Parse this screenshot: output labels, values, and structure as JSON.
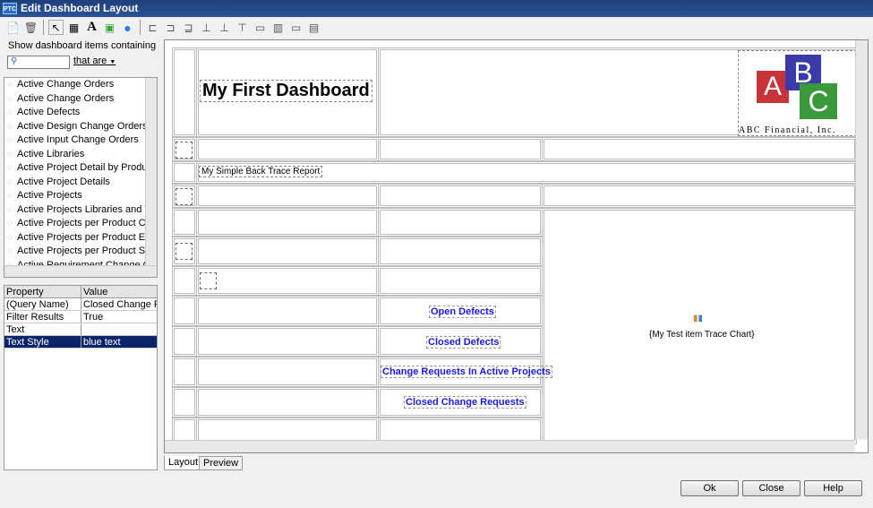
{
  "window": {
    "title": "Edit Dashboard Layout",
    "logo": "PTC"
  },
  "toolbar": {
    "icons": [
      "new-item-icon",
      "delete-icon",
      "pointer-icon",
      "table-icon",
      "text-icon",
      "image-icon",
      "globe-icon",
      "align-left-icon",
      "align-center-icon",
      "align-right-icon",
      "align-top-icon",
      "align-middle-icon",
      "align-bottom-icon",
      "insert-row-icon",
      "insert-column-icon",
      "merge-icon",
      "split-icon"
    ]
  },
  "filter": {
    "label": "Show dashboard items containing",
    "search_value": "",
    "that_are": "that are"
  },
  "items": [
    "Active Change Orders",
    "Active Change Orders",
    "Active Defects",
    "Active Design Change Orders",
    "Active Input Change Orders",
    "Active Libraries",
    "Active Project Detail by Product",
    "Active Project Details",
    "Active Projects",
    "Active Projects Libraries and Templates",
    "Active Projects per Product Cost S",
    "Active Projects per Product Effort",
    "Active Projects per Product Summa",
    "Active Requirement Change Orders"
  ],
  "properties": {
    "header": [
      "Property",
      "Value"
    ],
    "rows": [
      [
        "(Query Name)",
        "Closed Change R..."
      ],
      [
        "Filter Results",
        "True"
      ],
      [
        "Text",
        ""
      ],
      [
        "Text Style",
        "blue text"
      ]
    ],
    "selected": 3
  },
  "dashboard": {
    "title": "My First Dashboard",
    "report": "My Simple Back Trace Report",
    "logo_letters": [
      "A",
      "B",
      "C"
    ],
    "logo_caption": "ABC Financial, Inc.",
    "links": [
      "Open Defects",
      "Closed Defects",
      "Change Requests In Active Projects",
      "Closed Change Requests"
    ],
    "chart_label": "{My Test item Trace Chart}",
    "link_color": "#1a1ae6"
  },
  "tabs": [
    "Layout",
    "Preview"
  ],
  "buttons": {
    "ok": "Ok",
    "close": "Close",
    "help": "Help"
  }
}
